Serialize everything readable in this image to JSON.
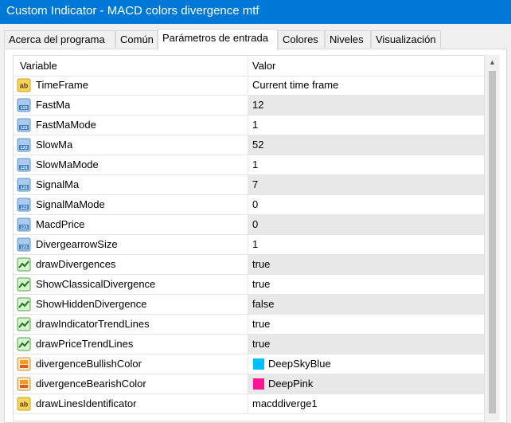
{
  "window": {
    "title": "Custom Indicator - MACD colors divergence mtf"
  },
  "tabs": [
    {
      "label": "Acerca del programa",
      "active": false
    },
    {
      "label": "Común",
      "active": false
    },
    {
      "label": "Parámetros de entrada",
      "active": true
    },
    {
      "label": "Colores",
      "active": false
    },
    {
      "label": "Niveles",
      "active": false
    },
    {
      "label": "Visualización",
      "active": false
    }
  ],
  "table": {
    "headers": {
      "variable": "Variable",
      "value": "Valor"
    },
    "rows": [
      {
        "name": "TimeFrame",
        "value": "Current time frame",
        "icon": "string-ab-icon"
      },
      {
        "name": "FastMa",
        "value": "12",
        "icon": "integer-123-icon"
      },
      {
        "name": "FastMaMode",
        "value": "1",
        "icon": "integer-123-icon"
      },
      {
        "name": "SlowMa",
        "value": "52",
        "icon": "integer-123-icon"
      },
      {
        "name": "SlowMaMode",
        "value": "1",
        "icon": "integer-123-icon"
      },
      {
        "name": "SignalMa",
        "value": "7",
        "icon": "integer-123-icon"
      },
      {
        "name": "SignalMaMode",
        "value": "0",
        "icon": "integer-123-icon"
      },
      {
        "name": "MacdPrice",
        "value": "0",
        "icon": "integer-123-icon"
      },
      {
        "name": "DivergearrowSize",
        "value": "1",
        "icon": "integer-123-icon"
      },
      {
        "name": "drawDivergences",
        "value": "true",
        "icon": "boolean-chart-icon"
      },
      {
        "name": "ShowClassicalDivergence",
        "value": "true",
        "icon": "boolean-chart-icon"
      },
      {
        "name": "ShowHiddenDivergence",
        "value": "false",
        "icon": "boolean-chart-icon"
      },
      {
        "name": "drawIndicatorTrendLines",
        "value": "true",
        "icon": "boolean-chart-icon"
      },
      {
        "name": "drawPriceTrendLines",
        "value": "true",
        "icon": "boolean-chart-icon"
      },
      {
        "name": "divergenceBullishColor",
        "value": "DeepSkyBlue",
        "icon": "color-icon",
        "swatch": "#00bfff"
      },
      {
        "name": "divergenceBearishColor",
        "value": "DeepPink",
        "icon": "color-icon",
        "swatch": "#ff1493"
      },
      {
        "name": "drawLinesIdentificator",
        "value": "macddiverge1",
        "icon": "string-ab-icon"
      }
    ]
  }
}
